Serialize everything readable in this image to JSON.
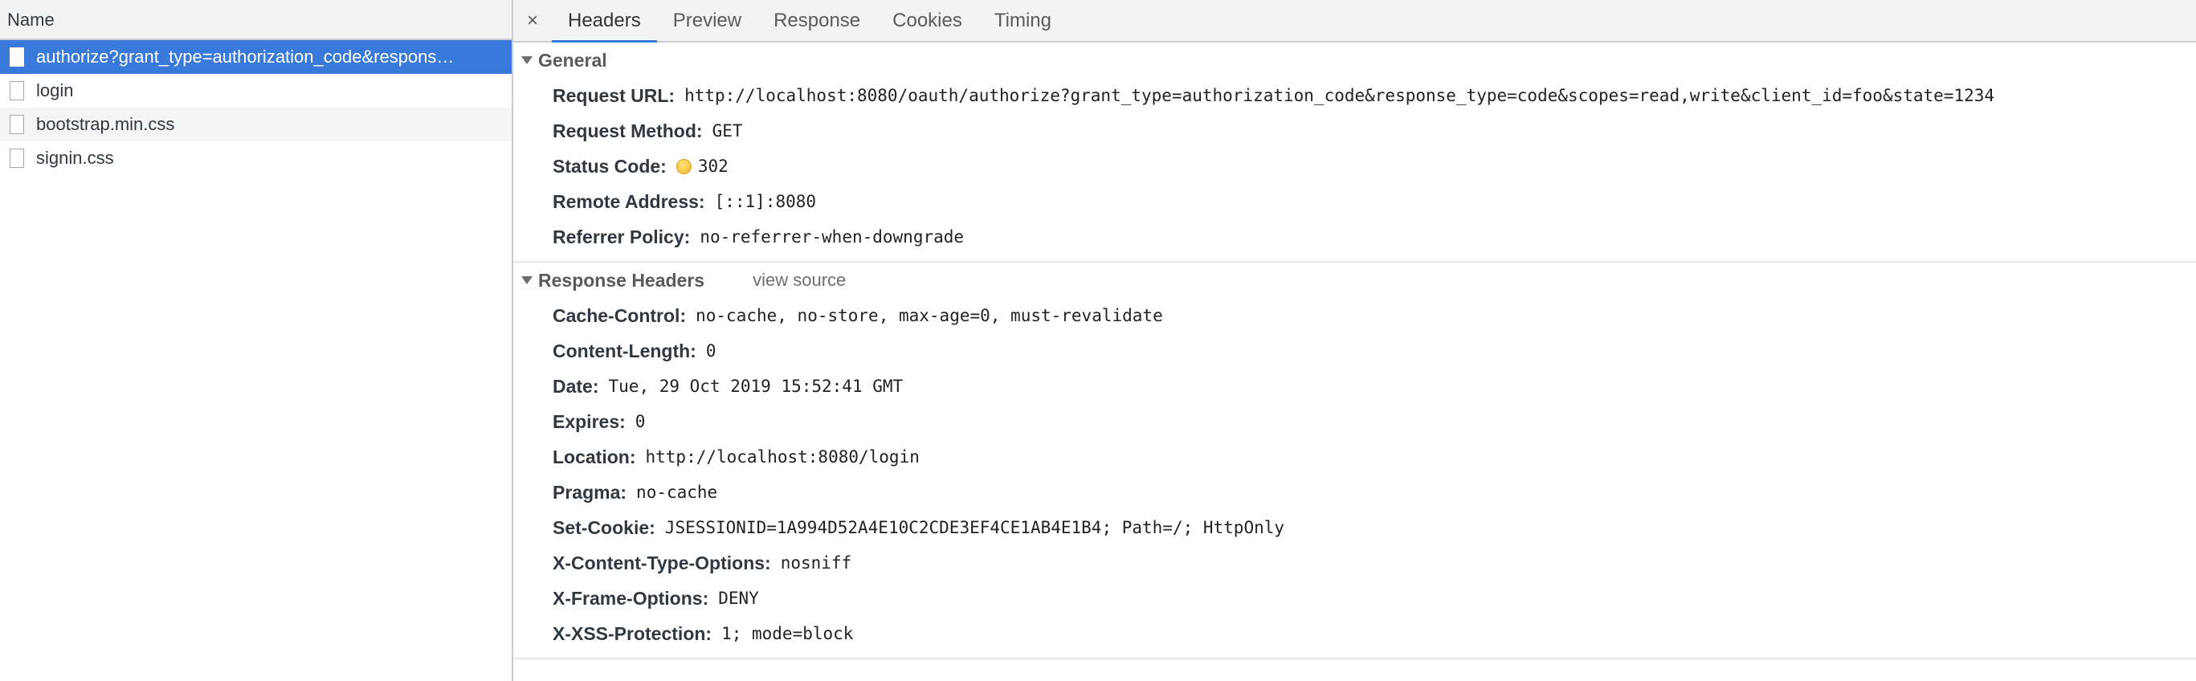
{
  "request_list": {
    "header": "Name",
    "items": [
      {
        "name": "authorize?grant_type=authorization_code&respons…"
      },
      {
        "name": "login"
      },
      {
        "name": "bootstrap.min.css"
      },
      {
        "name": "signin.css"
      }
    ]
  },
  "tabs": {
    "close_glyph": "×",
    "items": [
      "Headers",
      "Preview",
      "Response",
      "Cookies",
      "Timing"
    ],
    "active": "Headers"
  },
  "general": {
    "title": "General",
    "rows": [
      {
        "name": "Request URL:",
        "value": "http://localhost:8080/oauth/authorize?grant_type=authorization_code&response_type=code&scopes=read,write&client_id=foo&state=1234"
      },
      {
        "name": "Request Method:",
        "value": "GET"
      },
      {
        "name": "Status Code:",
        "value": "302",
        "status_color": "#f5c242"
      },
      {
        "name": "Remote Address:",
        "value": "[::1]:8080"
      },
      {
        "name": "Referrer Policy:",
        "value": "no-referrer-when-downgrade"
      }
    ]
  },
  "response_headers": {
    "title": "Response Headers",
    "view_source": "view source",
    "rows": [
      {
        "name": "Cache-Control:",
        "value": "no-cache, no-store, max-age=0, must-revalidate"
      },
      {
        "name": "Content-Length:",
        "value": "0"
      },
      {
        "name": "Date:",
        "value": "Tue, 29 Oct 2019 15:52:41 GMT"
      },
      {
        "name": "Expires:",
        "value": "0"
      },
      {
        "name": "Location:",
        "value": "http://localhost:8080/login"
      },
      {
        "name": "Pragma:",
        "value": "no-cache"
      },
      {
        "name": "Set-Cookie:",
        "value": "JSESSIONID=1A994D52A4E10C2CDE3EF4CE1AB4E1B4; Path=/; HttpOnly"
      },
      {
        "name": "X-Content-Type-Options:",
        "value": "nosniff"
      },
      {
        "name": "X-Frame-Options:",
        "value": "DENY"
      },
      {
        "name": "X-XSS-Protection:",
        "value": "1; mode=block"
      }
    ]
  },
  "colors": {
    "selection": "#3879d9",
    "active_tab_underline": "#3879d9"
  }
}
